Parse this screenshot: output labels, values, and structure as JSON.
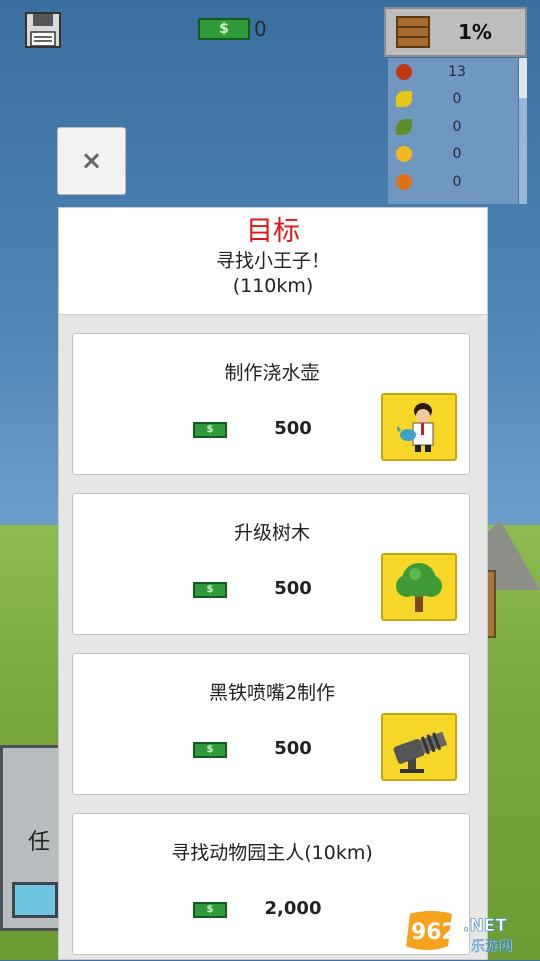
{
  "hud": {
    "money": "0",
    "storage_percent": "1%"
  },
  "inventory": [
    {
      "icon": "apple-icon",
      "color": "#c23616",
      "qty": "13"
    },
    {
      "icon": "banana-icon",
      "color": "#e8c51a",
      "qty": "0"
    },
    {
      "icon": "leaf-icon",
      "color": "#5c8f2a",
      "qty": "0"
    },
    {
      "icon": "lemon-icon",
      "color": "#f0b81c",
      "qty": "0"
    },
    {
      "icon": "orange-icon",
      "color": "#e07018",
      "qty": "0"
    }
  ],
  "dialog": {
    "close_label": "×",
    "title": "目标",
    "subtitle": "寻找小王子！",
    "distance": "(110km)"
  },
  "currency_symbol": "$",
  "goals": [
    {
      "name": "制作浇水壶",
      "price": "500",
      "icon": "scientist-watering-can-icon"
    },
    {
      "name": "升级树木",
      "price": "500",
      "icon": "tree-icon"
    },
    {
      "name": "黑铁喷嘴2制作",
      "price": "500",
      "icon": "cannon-nozzle-icon"
    },
    {
      "name": "寻找动物园主人(10km)",
      "price": "2,000",
      "icon": ""
    }
  ],
  "background": {
    "building_label": "任"
  },
  "watermark": {
    "number": "962",
    "suffix": ".NET",
    "caption": "乐游网"
  },
  "colors": {
    "title_red": "#e21616",
    "button_yellow": "#f6d626",
    "cash_green": "#2f9b3a"
  }
}
